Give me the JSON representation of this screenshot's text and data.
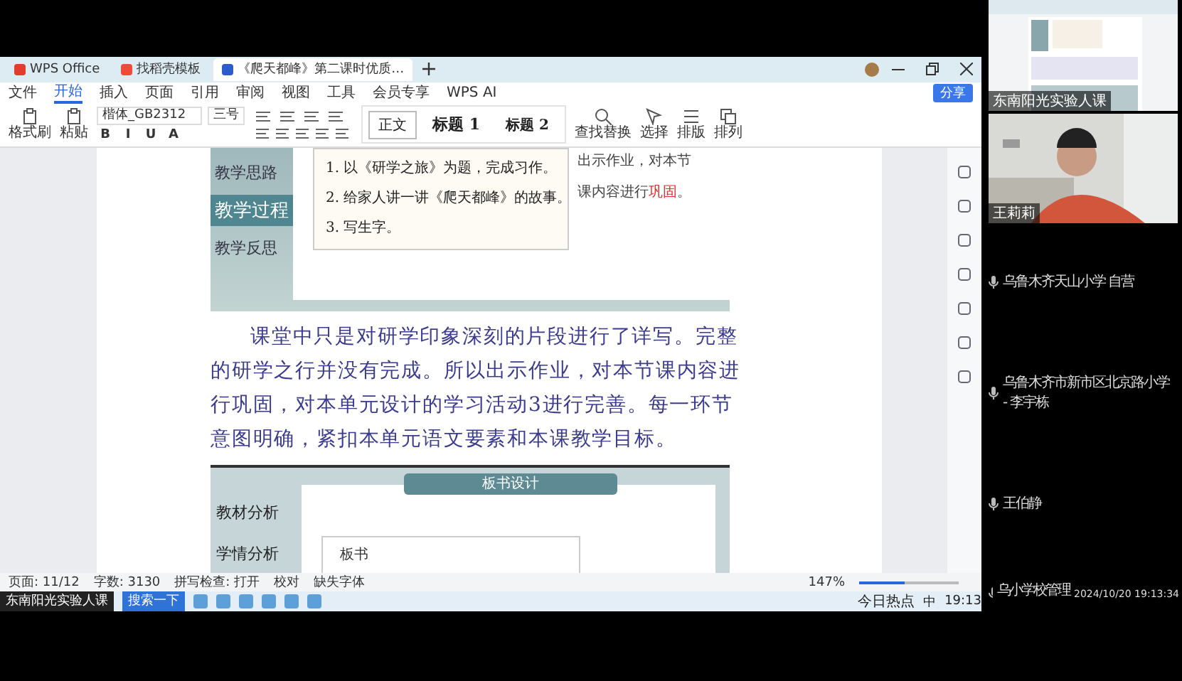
{
  "tabs": [
    {
      "label": "WPS Office",
      "kind": "app",
      "selected": false
    },
    {
      "label": "找稻壳模板",
      "kind": "template",
      "selected": false
    },
    {
      "label": "《爬天都峰》第二课时优质…",
      "kind": "doc",
      "selected": true
    }
  ],
  "menu": [
    {
      "label": "文件",
      "selected": false
    },
    {
      "label": "开始",
      "selected": true
    },
    {
      "label": "插入",
      "selected": false
    },
    {
      "label": "页面",
      "selected": false
    },
    {
      "label": "引用",
      "selected": false
    },
    {
      "label": "审阅",
      "selected": false
    },
    {
      "label": "视图",
      "selected": false
    },
    {
      "label": "工具",
      "selected": false
    },
    {
      "label": "会员专享",
      "selected": false
    },
    {
      "label": "WPS AI",
      "selected": false
    }
  ],
  "share_button": "分享",
  "toolbar": {
    "clipboard": [
      "格式刷",
      "粘贴"
    ],
    "font": "楷体_GB2312",
    "size": "三号",
    "format": [
      "B",
      "I",
      "U",
      "A"
    ],
    "styles": [
      {
        "label": "正文",
        "selected": true
      },
      {
        "label": "标题 1",
        "selected": false
      },
      {
        "label": "标题 2",
        "selected": false
      }
    ],
    "tools": [
      "查找替换",
      "选择",
      "排版",
      "排列"
    ]
  },
  "document": {
    "slide1": {
      "nav": [
        {
          "label": "教学思路",
          "selected": false
        },
        {
          "label": "教学过程",
          "selected": true
        },
        {
          "label": "教学反思",
          "selected": false
        }
      ],
      "tasks": [
        "1. 以《研学之旅》为题，完成习作。",
        "2. 给家人讲一讲《爬天都峰》的故事。",
        "3. 写生字。"
      ],
      "side_lines": [
        [
          {
            "text": "出示作业，对本节",
            "highlight": false
          }
        ],
        [
          {
            "text": "课内容进行",
            "highlight": false
          },
          {
            "text": "巩固",
            "highlight": true
          },
          {
            "text": "。",
            "highlight": false
          }
        ]
      ]
    },
    "paragraph": "课堂中只是对研学印象深刻的片段进行了详写。完整的研学之行并没有完成。所以出示作业，对本节课内容进行巩固，对本单元设计的学习活动3进行完善。每一环节意图明确，紧扣本单元语文要素和本课教学目标。",
    "slide2": {
      "title": "板书设计",
      "nav": [
        "教材分析",
        "学情分析"
      ],
      "board_label": "板书"
    }
  },
  "status_bar": {
    "page": "页面: 11/12",
    "words": "字数: 3130",
    "spell": "拼写检查: 打开",
    "proof": "校对",
    "missing_font": "缺失字体",
    "zoom": "147%",
    "zoom_slider": {
      "level": 0.45
    }
  },
  "taskbar": {
    "window": "东南阳光实验人课",
    "search": "搜索一下",
    "news": "今日热点",
    "ime": "中",
    "time": "19:13"
  },
  "meeting": {
    "share_caption": "东南阳光实验人课",
    "camera_caption": "王莉莉",
    "participants": [
      "乌鲁木齐天山小学 自营",
      "乌鲁木齐市新市区北京路小学 - 李宇栋",
      "王伯静",
      "乌小学校管理"
    ],
    "datetime": "2024/10/20 19:13:34"
  }
}
